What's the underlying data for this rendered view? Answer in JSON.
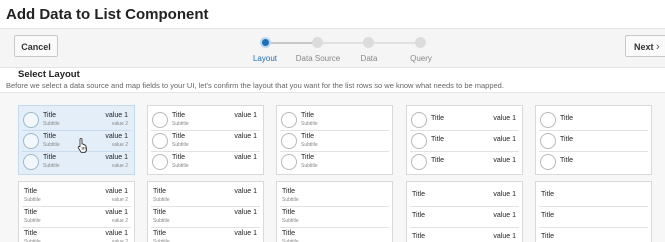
{
  "page": {
    "title": "Add Data to List Component"
  },
  "toolbar": {
    "cancel_label": "Cancel",
    "next_label": "Next",
    "next_icon": "chevron-right-icon"
  },
  "train": {
    "steps": [
      {
        "label": "Layout",
        "state": "active"
      },
      {
        "label": "Data Source",
        "state": "pending"
      },
      {
        "label": "Data",
        "state": "pending"
      },
      {
        "label": "Query",
        "state": "pending"
      }
    ],
    "accent": "#1f6fb8"
  },
  "section": {
    "heading": "Select Layout",
    "description": "Before we select a data source and map fields to your UI, let's confirm the layout that you want for the list rows so we know what needs to be mapped."
  },
  "row_text": {
    "title": "Title",
    "subtitle": "Subtitle",
    "value1": "value 1",
    "value2": "value 2"
  },
  "layouts": [
    {
      "id": "circle-title-subtitle-two-values",
      "selected": true
    },
    {
      "id": "circle-title-subtitle-one-value",
      "selected": false
    },
    {
      "id": "circle-title-subtitle",
      "selected": false
    },
    {
      "id": "circle-title-one-value",
      "selected": false
    },
    {
      "id": "circle-title",
      "selected": false
    },
    {
      "id": "title-subtitle-two-values",
      "selected": false
    },
    {
      "id": "title-subtitle-one-value",
      "selected": false
    },
    {
      "id": "title-subtitle",
      "selected": false
    },
    {
      "id": "title-one-value",
      "selected": false
    },
    {
      "id": "title-only",
      "selected": false
    }
  ]
}
